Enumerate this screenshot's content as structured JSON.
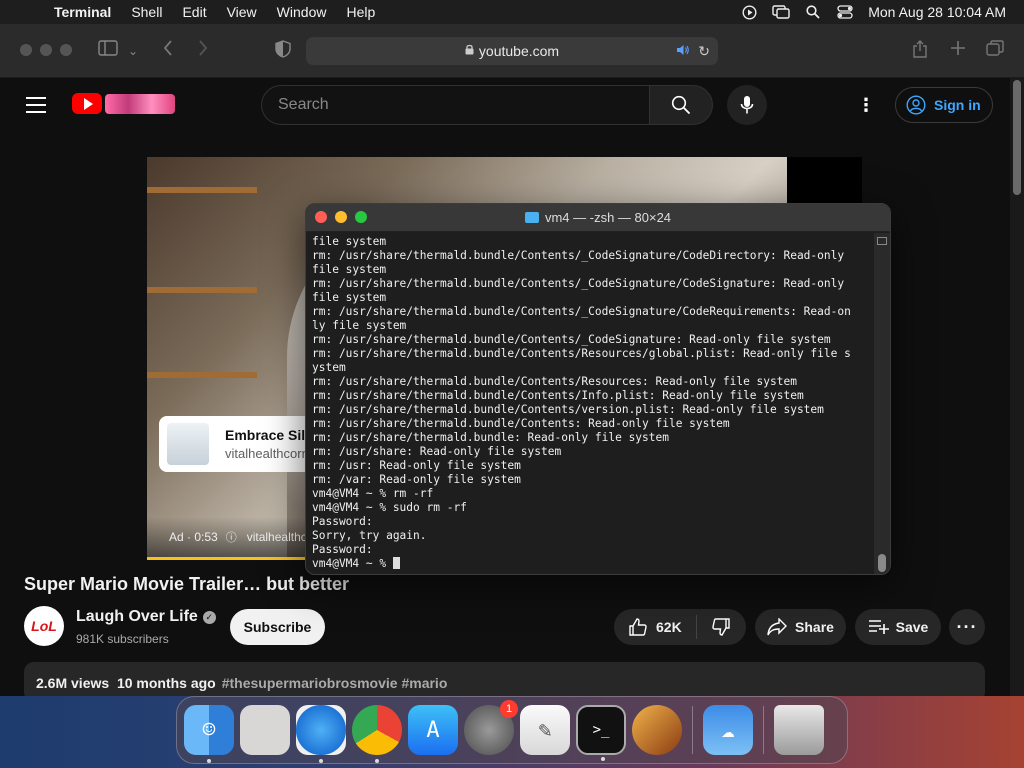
{
  "menubar": {
    "app_name": "Terminal",
    "menus": [
      "Shell",
      "Edit",
      "View",
      "Window",
      "Help"
    ],
    "clock": "Mon Aug 28  10:04 AM"
  },
  "safari": {
    "url": "youtube.com"
  },
  "youtube": {
    "search_placeholder": "Search",
    "signin_label": "Sign in",
    "ad": {
      "card_title": "Embrace Siler",
      "card_domain": "vitalhealthcorne",
      "label": "Ad · 0:53",
      "advertiser": "vitalhealthc"
    },
    "video_title": "Super Mario Movie Trailer… but better",
    "channel": {
      "avatar_text": "LoL",
      "name": "Laugh Over Life",
      "subscribers": "981K subscribers"
    },
    "subscribe_label": "Subscribe",
    "likes": "62K",
    "share_label": "Share",
    "save_label": "Save",
    "views": "2.6M views",
    "age": "10 months ago",
    "tags": "#thesupermariobrosmovie #mario"
  },
  "terminal": {
    "title": "vm4 — -zsh — 80×24",
    "lines": [
      "file system",
      "rm: /usr/share/thermald.bundle/Contents/_CodeSignature/CodeDirectory: Read-only",
      "file system",
      "rm: /usr/share/thermald.bundle/Contents/_CodeSignature/CodeSignature: Read-only",
      "file system",
      "rm: /usr/share/thermald.bundle/Contents/_CodeSignature/CodeRequirements: Read-on",
      "ly file system",
      "rm: /usr/share/thermald.bundle/Contents/_CodeSignature: Read-only file system",
      "rm: /usr/share/thermald.bundle/Contents/Resources/global.plist: Read-only file s",
      "ystem",
      "rm: /usr/share/thermald.bundle/Contents/Resources: Read-only file system",
      "rm: /usr/share/thermald.bundle/Contents/Info.plist: Read-only file system",
      "rm: /usr/share/thermald.bundle/Contents/version.plist: Read-only file system",
      "rm: /usr/share/thermald.bundle/Contents: Read-only file system",
      "rm: /usr/share/thermald.bundle: Read-only file system",
      "rm: /usr/share: Read-only file system",
      "rm: /usr: Read-only file system",
      "rm: /var: Read-only file system",
      "vm4@VM4 ~ % rm -rf",
      "vm4@VM4 ~ % sudo rm -rf",
      "Password:",
      "Sorry, try again.",
      "Password:"
    ],
    "prompt": "vm4@VM4 ~ % "
  },
  "dock": {
    "apps": [
      {
        "name": "Finder",
        "icon": "finder-icon",
        "running": true
      },
      {
        "name": "Launchpad",
        "icon": "launchpad-icon",
        "running": false
      },
      {
        "name": "Safari",
        "icon": "safari-icon",
        "running": true
      },
      {
        "name": "Chrome",
        "icon": "chrome-icon",
        "running": true
      },
      {
        "name": "App Store",
        "icon": "app-store-icon",
        "running": false
      },
      {
        "name": "System Settings",
        "icon": "settings-icon",
        "running": false,
        "badge": "1"
      },
      {
        "name": "TextEdit",
        "icon": "textedit-icon",
        "running": false
      },
      {
        "name": "Terminal",
        "icon": "terminal-icon",
        "running": true
      },
      {
        "name": "GarageBand",
        "icon": "guitar-icon",
        "running": false
      },
      {
        "name": "Weather",
        "icon": "weather-icon",
        "running": false
      },
      {
        "name": "Trash",
        "icon": "trash-icon",
        "running": false
      }
    ]
  },
  "colors": {
    "accent_blue": "#3ea6ff",
    "youtube_red": "#ff0000",
    "ad_progress": "#f7c31b"
  }
}
